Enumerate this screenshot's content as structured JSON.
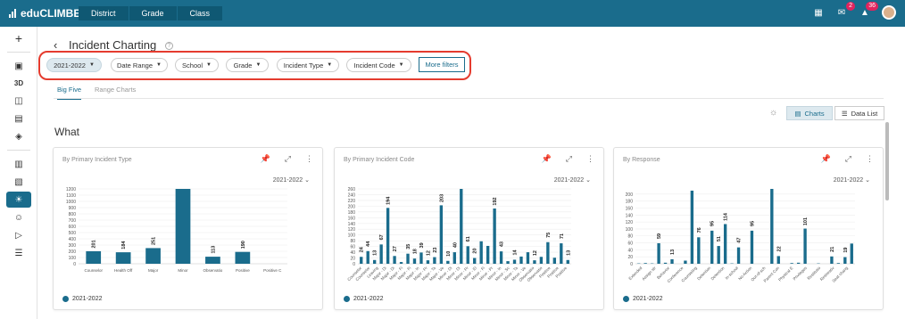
{
  "app": {
    "name": "eduCLIMBER"
  },
  "nav": {
    "tabs": [
      "District",
      "Grade",
      "Class"
    ]
  },
  "header_badges": {
    "messages": "2",
    "notifications": "36"
  },
  "page": {
    "title": "Incident Charting",
    "back_icon": "‹"
  },
  "filters": {
    "year": "2021-2022",
    "date_range": "Date Range",
    "school": "School",
    "grade": "Grade",
    "incident_type": "Incident Type",
    "incident_code": "Incident Code",
    "more": "More filters"
  },
  "tabs": {
    "big_five": "Big Five",
    "range_charts": "Range Charts"
  },
  "view_toggle": {
    "charts": "Charts",
    "data_list": "Data List"
  },
  "section": {
    "title": "What"
  },
  "colors": {
    "accent": "#1a6c8c",
    "highlight": "#e53b2e"
  },
  "cards": [
    {
      "title": "By Primary Incident Type",
      "year": "2021-2022",
      "legend": "2021-2022"
    },
    {
      "title": "By Primary Incident Code",
      "year": "2021-2022",
      "legend": "2021-2022"
    },
    {
      "title": "By Response",
      "year": "2021-2022",
      "legend": "2021-2022"
    }
  ],
  "chart_data": [
    {
      "type": "bar",
      "title": "By Primary Incident Type",
      "categories": [
        "Counselor",
        "Health Off",
        "Major",
        "Minor",
        "Observatio",
        "Positive",
        "Positive C"
      ],
      "values": [
        201,
        184,
        251,
        1200,
        113,
        190,
        0
      ],
      "data_labels": [
        "201",
        "184",
        "251",
        "",
        "113",
        "190",
        ""
      ],
      "yticks": [
        0,
        100,
        200,
        300,
        400,
        500,
        600,
        700,
        800,
        900,
        1000,
        1100,
        1200
      ],
      "ylim": [
        0,
        1200
      ],
      "legend": "2021-2022"
    },
    {
      "type": "bar",
      "title": "By Primary Incident Code",
      "categories": [
        "Counselor",
        "Counselor",
        "Leaving",
        "Major - Di",
        "Major - Di",
        "Major - Fi",
        "Major - Fi",
        "Major - In",
        "Major - Pr",
        "Major - Ta",
        "Major - Ve",
        "Minor - Di",
        "Minor - Di",
        "Minor - Pr",
        "Minor - El",
        "Minor - Fi",
        "Minor - Pr",
        "Minor - In",
        "Minor - Sc",
        "Minor - Ta",
        "Minor - Ve",
        "Observatio",
        "Observatio",
        "Positive",
        "Positive",
        "Positive"
      ],
      "values": [
        24,
        44,
        13,
        67,
        194,
        27,
        6,
        35,
        18,
        39,
        12,
        23,
        203,
        10,
        40,
        260,
        61,
        20,
        78,
        62,
        192,
        43,
        9,
        14,
        25,
        40,
        12,
        24,
        75,
        21,
        71,
        13
      ],
      "data_labels": [
        "24",
        "44",
        "13",
        "67",
        "194",
        "27",
        "",
        "35",
        "18",
        "39",
        "12",
        "23",
        "203",
        "10",
        "40",
        "",
        "61",
        "20",
        "",
        "",
        "192",
        "43",
        "",
        "14",
        "",
        "",
        "12",
        "",
        "75",
        "",
        "71",
        "13"
      ],
      "yticks": [
        0,
        20,
        40,
        60,
        80,
        100,
        120,
        140,
        160,
        180,
        200,
        220,
        240,
        260
      ],
      "ylim": [
        0,
        260
      ],
      "legend": "2021-2022"
    },
    {
      "type": "bar",
      "title": "By Response",
      "categories": [
        "Extended",
        "Assign str",
        "Behavior",
        "Conference",
        "Counseling",
        "Detention",
        "Detention",
        "In-school",
        "No Action",
        "Out-of-sch",
        "Parent Con",
        "Physical E",
        "Privileges",
        "Restitutio",
        "Restorativ",
        "Seat chang"
      ],
      "values": [
        1,
        2,
        1,
        59,
        3,
        13,
        0,
        9,
        210,
        76,
        0,
        95,
        51,
        114,
        1,
        47,
        0,
        95,
        0,
        0,
        215,
        22,
        0,
        2,
        3,
        101,
        0,
        1,
        0,
        21,
        2,
        19,
        58
      ],
      "data_labels": [
        "",
        "",
        "",
        "59",
        "",
        "13",
        "",
        "",
        "",
        "76",
        "",
        "95",
        "51",
        "114",
        "",
        "47",
        "",
        "95",
        "",
        "",
        "",
        "22",
        "",
        "",
        "",
        "101",
        "",
        "",
        "",
        "21",
        "",
        "19",
        ""
      ],
      "yticks": [
        0,
        20,
        40,
        60,
        80,
        100,
        120,
        140,
        160,
        180,
        200
      ],
      "ylim": [
        0,
        215
      ],
      "legend": "2021-2022"
    }
  ]
}
